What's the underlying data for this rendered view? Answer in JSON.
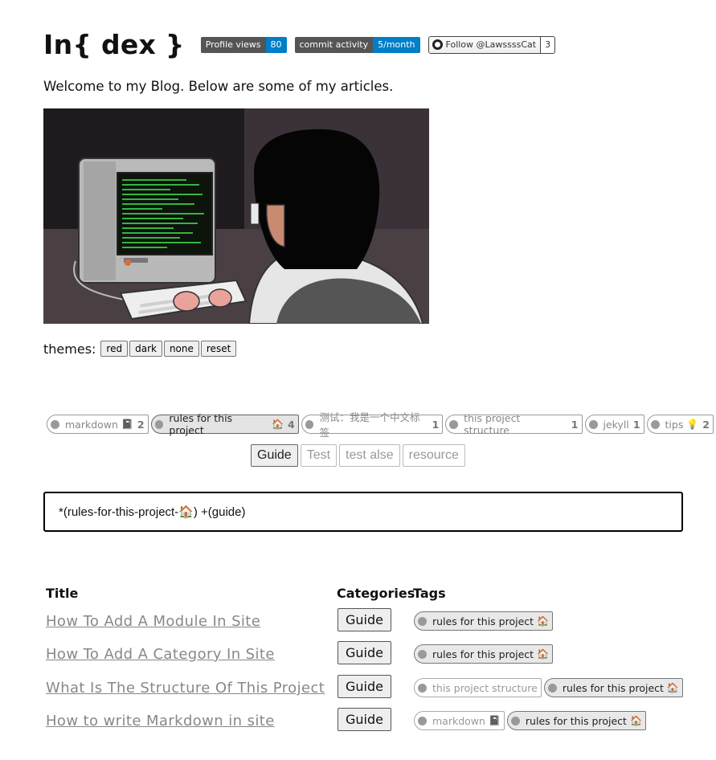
{
  "header": {
    "title": "In{ dex }",
    "badges": [
      {
        "label": "Profile views",
        "value": "80",
        "color": "#007ec6"
      },
      {
        "label": "commit activity",
        "value": "5/month",
        "color": "#007ec6"
      }
    ],
    "github": {
      "label": "Follow @LawssssCat",
      "count": "3"
    }
  },
  "intro": "Welcome to my Blog. Below are some of my articles.",
  "themes": {
    "label": "themes:",
    "options": [
      "red",
      "dark",
      "none",
      "reset"
    ]
  },
  "tags": [
    {
      "name": "markdown",
      "icon": "book-icon",
      "glyph": "📓",
      "count": "2",
      "active": false
    },
    {
      "name": "rules for this project",
      "icon": "house-icon",
      "glyph": "🏠",
      "count": "4",
      "active": true
    },
    {
      "name": "测试：我是一个中文标签",
      "icon": "",
      "glyph": "",
      "count": "1",
      "active": false
    },
    {
      "name": "this project structure",
      "icon": "",
      "glyph": "",
      "count": "1",
      "active": false
    },
    {
      "name": "jekyll",
      "icon": "",
      "glyph": "",
      "count": "1",
      "active": false
    },
    {
      "name": "tips",
      "icon": "lightbulb-icon",
      "glyph": "💡",
      "count": "2",
      "active": false
    }
  ],
  "categories": [
    {
      "name": "Guide",
      "active": true
    },
    {
      "name": "Test",
      "active": false
    },
    {
      "name": "test alse",
      "active": false
    },
    {
      "name": "resource",
      "active": false
    }
  ],
  "query": "*(rules-for-this-project-🏠) +(guide)",
  "table": {
    "headers": {
      "title": "Title",
      "categories": "Categories",
      "tags": "Tags"
    },
    "rows": [
      {
        "title": "How To Add A Module In Site",
        "category": "Guide",
        "tags": [
          {
            "name": "rules for this project",
            "glyph": "🏠",
            "active": true
          }
        ]
      },
      {
        "title": "How To Add A Category In Site",
        "category": "Guide",
        "tags": [
          {
            "name": "rules for this project",
            "glyph": "🏠",
            "active": true
          }
        ]
      },
      {
        "title": "What Is The Structure Of This Project",
        "category": "Guide",
        "tags": [
          {
            "name": "this project structure",
            "glyph": "",
            "active": false
          },
          {
            "name": "rules for this project",
            "glyph": "🏠",
            "active": true
          }
        ]
      },
      {
        "title": "How to write Markdown in site",
        "category": "Guide",
        "tags": [
          {
            "name": "markdown",
            "glyph": "📓",
            "active": false
          },
          {
            "name": "rules for this project",
            "glyph": "🏠",
            "active": true
          }
        ]
      }
    ]
  }
}
